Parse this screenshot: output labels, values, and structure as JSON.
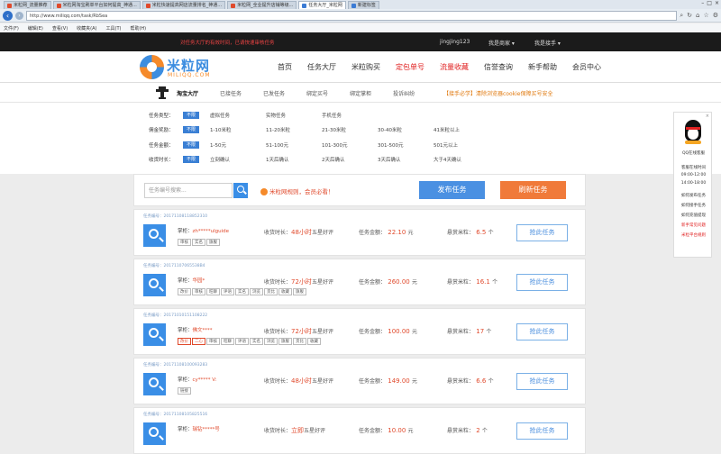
{
  "browser": {
    "tabs": [
      {
        "label": "米粒网_流量推荐",
        "active": false
      },
      {
        "label": "米粒网淘宝刷单平台如何提高_神通...",
        "active": false
      },
      {
        "label": "米粒快速提高网店流量排名_神通...",
        "active": false
      },
      {
        "label": "米粒网_全业提升店铺等级...",
        "active": false
      },
      {
        "label": "任务大厅_米粒网",
        "active": true
      },
      {
        "label": "新建标签",
        "active": false
      }
    ],
    "url": "http://www.miliqq.com/task/RbSea",
    "menu": [
      "文件(F)",
      "编辑(E)",
      "查看(V)",
      "收藏夹(A)",
      "工具(T)",
      "帮助(H)"
    ]
  },
  "topbar": {
    "notice": "对任务大厅的有效时间，已请快速审核任务",
    "user": "jingjing123",
    "menu_seller": "我是商家 ▾",
    "menu_buyer": "我是接手 ▾"
  },
  "logo": {
    "cn": "米粒网",
    "en": "MILIQQ.COM"
  },
  "mainnav": [
    {
      "label": "首页",
      "red": false
    },
    {
      "label": "任务大厅",
      "red": false
    },
    {
      "label": "米粒购买",
      "red": false
    },
    {
      "label": "定包单号",
      "red": true
    },
    {
      "label": "流量收藏",
      "red": true
    },
    {
      "label": "信誉查询",
      "red": false
    },
    {
      "label": "新手帮助",
      "red": false
    },
    {
      "label": "会员中心",
      "red": false
    }
  ],
  "subnav": {
    "items": [
      "淘宝大厅",
      "已接任务",
      "已发任务",
      "绑定买号",
      "绑定掌柜",
      "投诉纠纷"
    ],
    "promo": "【接手必学】清除浏览器cookie保障买号安全"
  },
  "filters": [
    {
      "label": "任务类型：",
      "all": "不限",
      "options": [
        "虚拟任务",
        "实物任务",
        "手机任务"
      ]
    },
    {
      "label": "佣金奖励：",
      "all": "不限",
      "options": [
        "1-10米粒",
        "11-20米粒",
        "21-30米粒",
        "30-40米粒",
        "41米粒以上"
      ]
    },
    {
      "label": "任务金额：",
      "all": "不限",
      "options": [
        "1-50元",
        "51-100元",
        "101-300元",
        "301-500元",
        "501元以上"
      ]
    },
    {
      "label": "收货时长：",
      "all": "不限",
      "options": [
        "立刻确认",
        "1天后确认",
        "2天后确认",
        "3天后确认",
        "大于4天确认"
      ]
    }
  ],
  "search": {
    "placeholder": "任务编号搜索...",
    "rule": "米粒网规则，会员必看！",
    "publish": "发布任务",
    "refresh": "刷新任务"
  },
  "card_labels": {
    "id_prefix": "任务编号：",
    "shop": "掌柜：",
    "time": "收货时长：",
    "amount": "任务金额：",
    "reward": "悬赏米粒：",
    "button": "抢此任务",
    "rating": "五星好评",
    "yuan": "元",
    "unit": "个"
  },
  "tasks": [
    {
      "id": "20171108118852310",
      "shop": "zh*****ulguide",
      "time": "48小时",
      "amount": "22.10",
      "reward": "6.5",
      "tags": [
        "审核",
        "实名",
        "旗舰"
      ]
    },
    {
      "id": "20171107065538B4",
      "shop": "华园*",
      "time": "72小时",
      "amount": "260.00",
      "reward": "16.1",
      "tags": [
        "改价",
        "审核",
        "旺聊",
        "评语",
        "实名",
        "浏览",
        "货比",
        "收藏",
        "旗舰"
      ]
    },
    {
      "id": "20171010151108222",
      "shop": "佛文****",
      "time": "72小时",
      "amount": "100.00",
      "reward": "17",
      "tags": [
        "改价",
        "二心",
        "审核",
        "旺聊",
        "评语",
        "实名",
        "浏览",
        "旗舰",
        "货比",
        "收藏"
      ]
    },
    {
      "id": "20171108100093283",
      "shop": "cy***** V:",
      "time": "48小时",
      "amount": "149.00",
      "reward": "6.6",
      "tags": [
        "链接"
      ]
    },
    {
      "id": "20171108105825516",
      "shop": "瑞钻*****号",
      "time": "立即",
      "amount": "10.00",
      "reward": "2",
      "tags": []
    }
  ],
  "qq": {
    "service": "QQ在线客服",
    "hours_title": "客服在线时间",
    "hours1": "09:00-12:00",
    "hours2": "14:00-18:00",
    "links": [
      "如何发布任务",
      "如何接手任务",
      "如何充值提现",
      "新手常见问题",
      "米粒平台规则"
    ]
  }
}
